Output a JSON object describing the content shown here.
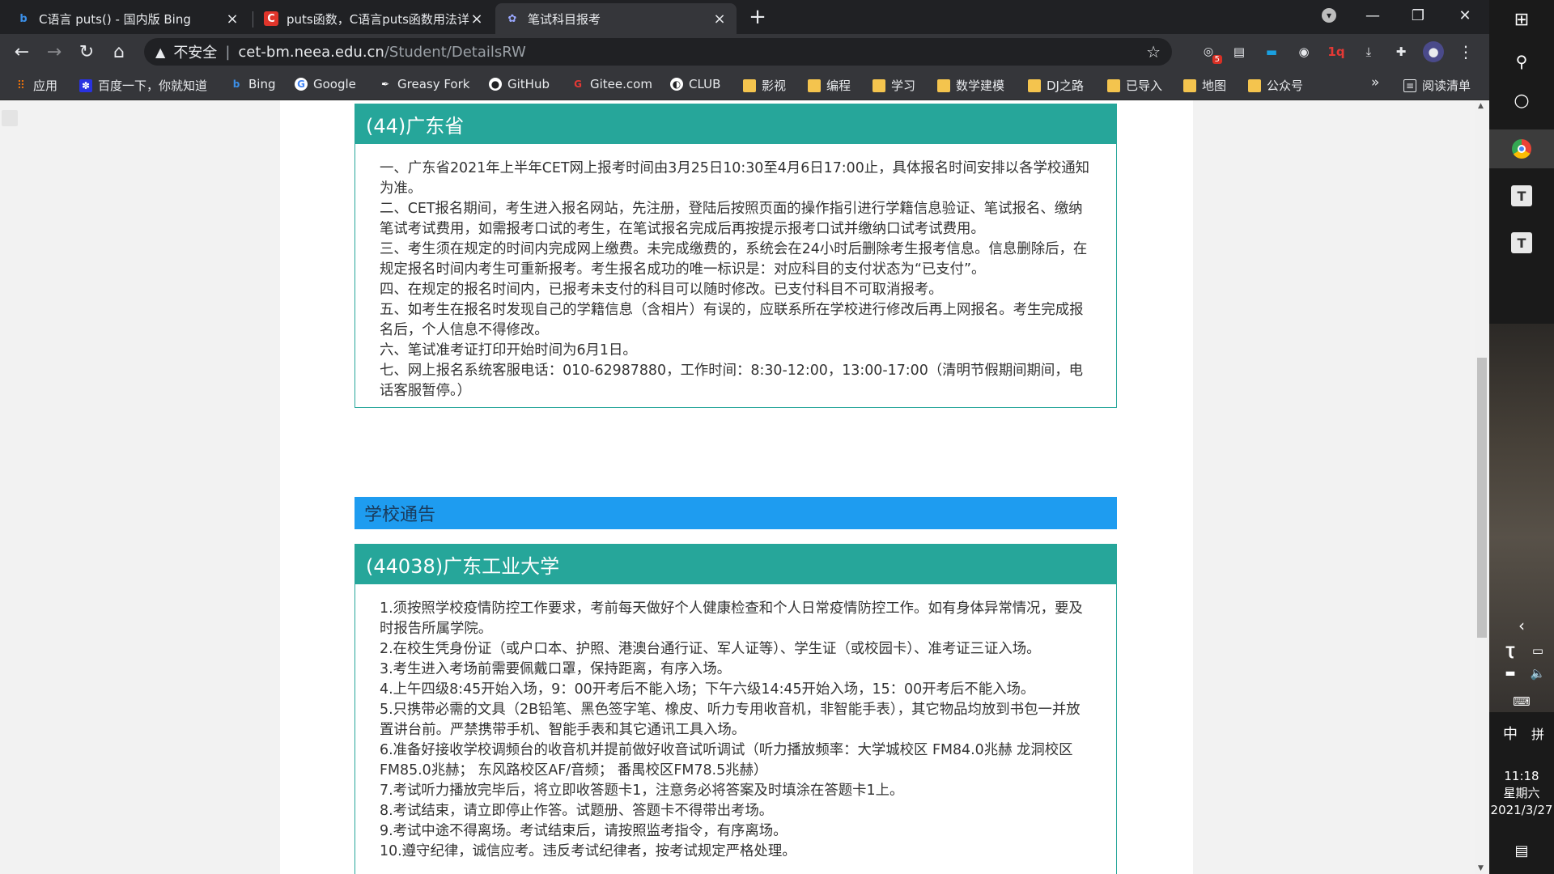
{
  "browser": {
    "tabs": [
      {
        "title": "C语言 puts() - 国内版 Bing",
        "favicon": "bing-icon"
      },
      {
        "title": "puts函数，C语言puts函数用法详解",
        "favicon": "c-biancheng-icon"
      },
      {
        "title": "笔试科目报考",
        "favicon": "neea-icon"
      }
    ],
    "omnibox": {
      "security_label": "不安全",
      "host": "cet-bm.neea.edu.cn",
      "path": "/Student/DetailsRW"
    },
    "extension_badge": "5",
    "bookmarks": [
      {
        "label": "应用",
        "icon": "apps-grid-icon"
      },
      {
        "label": "百度一下，你就知道",
        "icon": "baidu-icon"
      },
      {
        "label": "Bing",
        "icon": "bing-icon"
      },
      {
        "label": "Google",
        "icon": "google-icon"
      },
      {
        "label": "Greasy Fork",
        "icon": "greasyfork-icon"
      },
      {
        "label": "GitHub",
        "icon": "github-icon"
      },
      {
        "label": "Gitee.com",
        "icon": "gitee-icon"
      },
      {
        "label": "CLUB",
        "icon": "globe-icon"
      },
      {
        "label": "影视",
        "icon": "folder-icon"
      },
      {
        "label": "编程",
        "icon": "folder-icon"
      },
      {
        "label": "学习",
        "icon": "folder-icon"
      },
      {
        "label": "数学建模",
        "icon": "folder-icon"
      },
      {
        "label": "DJ之路",
        "icon": "folder-icon"
      },
      {
        "label": "已导入",
        "icon": "folder-icon"
      },
      {
        "label": "地图",
        "icon": "folder-icon"
      },
      {
        "label": "公众号",
        "icon": "folder-icon"
      }
    ],
    "bookmarks_overflow": "»",
    "reading_list": "阅读清单"
  },
  "page": {
    "province_panel": {
      "title": "(44)广东省",
      "lines": [
        "一、广东省2021年上半年CET网上报考时间由3月25日10:30至4月6日17:00止，具体报名时间安排以各学校通知为准。",
        "二、CET报名期间，考生进入报名网站，先注册，登陆后按照页面的操作指引进行学籍信息验证、笔试报名、缴纳笔试考试费用，如需报考口试的考生，在笔试报名完成后再按提示报考口试并缴纳口试考试费用。",
        "三、考生须在规定的时间内完成网上缴费。未完成缴费的，系统会在24小时后删除考生报考信息。信息删除后，在规定报名时间内考生可重新报考。考生报名成功的唯一标识是：对应科目的支付状态为“已支付”。",
        "四、在规定的报名时间内，已报考未支付的科目可以随时修改。已支付科目不可取消报考。",
        "五、如考生在报名时发现自己的学籍信息（含相片）有误的，应联系所在学校进行修改后再上网报名。考生完成报名后，个人信息不得修改。",
        "六、笔试准考证打印开始时间为6月1日。",
        "七、网上报名系统客服电话：010-62987880，工作时间：8:30-12:00，13:00-17:00（清明节假期间期间，电话客服暂停。）"
      ]
    },
    "school_notice_title": "学校通告",
    "school_panel": {
      "title": "(44038)广东工业大学",
      "lines": [
        "1.须按照学校疫情防控工作要求，考前每天做好个人健康检查和个人日常疫情防控工作。如有身体异常情况，要及时报告所属学院。",
        "2.在校生凭身份证（或户口本、护照、港澳台通行证、军人证等）、学生证（或校园卡）、准考证三证入场。",
        "3.考生进入考场前需要佩戴口罩，保持距离，有序入场。",
        "4.上午四级8:45开始入场，9：00开考后不能入场；下午六级14:45开始入场，15：00开考后不能入场。",
        "5.只携带必需的文具（2B铅笔、黑色签字笔、橡皮、听力专用收音机，非智能手表），其它物品均放到书包一并放置讲台前。严禁携带手机、智能手表和其它通讯工具入场。",
        "6.准备好接收学校调频台的收音机并提前做好收音试听调试（听力播放频率：大学城校区 FM84.0兆赫  龙洞校区FM85.0兆赫；  东风路校区AF/音频；  番禺校区FM78.5兆赫）",
        "7.考试听力播放完毕后，将立即收答题卡1，注意务必将答案及时填涂在答题卡1上。",
        "8.考试结束，请立即停止作答。试题册、答题卡不得带出考场。",
        "9.考试中途不得离场。考试结束后，请按照监考指令，有序离场。",
        "10.遵守纪律，诚信应考。违反考试纪律者，按考试规定严格处理。"
      ]
    }
  },
  "taskbar": {
    "ime_mode": "中",
    "ime_layout": "拼",
    "time": "11:18",
    "weekday": "星期六",
    "date": "2021/3/27"
  },
  "colors": {
    "panel_header": "#26a69a",
    "notice_bar": "#1e9cf0"
  }
}
